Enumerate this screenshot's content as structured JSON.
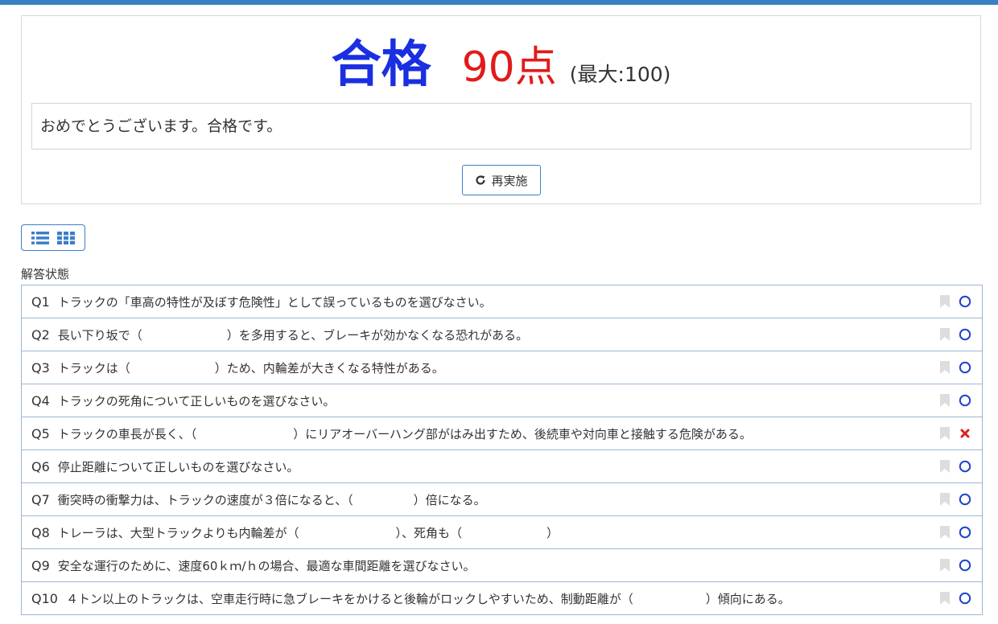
{
  "result": {
    "pass_label": "合格",
    "score": "90点",
    "max_score": "(最大:100)",
    "message": "おめでとうございます。合格です。",
    "retry_label": "再実施"
  },
  "colors": {
    "pass": "#1a2fe0",
    "score": "#e21a1a",
    "accent": "#3a7fc6",
    "correct": "#1f45c9",
    "incorrect": "#e02020",
    "bookmark": "#dddddd"
  },
  "view_toggle": {
    "icons": [
      "list-icon",
      "grid-icon"
    ]
  },
  "answer_status": {
    "label": "解答状態",
    "questions": [
      {
        "num": "Q1",
        "text": "トラックの「車高の特性が及ぼす危険性」として誤っているものを選びなさい。",
        "result": "correct"
      },
      {
        "num": "Q2",
        "text": "長い下り坂で（　　　　　　　）を多用すると、ブレーキが効かなくなる恐れがある。",
        "result": "correct"
      },
      {
        "num": "Q3",
        "text": "トラックは（　　　　　　　）ため、内輪差が大きくなる特性がある。",
        "result": "correct"
      },
      {
        "num": "Q4",
        "text": "トラックの死角について正しいものを選びなさい。",
        "result": "correct"
      },
      {
        "num": "Q5",
        "text": "トラックの車長が長く、（　　　　　　　　）にリアオーバーハング部がはみ出すため、後続車や対向車と接触する危険がある。",
        "result": "incorrect"
      },
      {
        "num": "Q6",
        "text": "停止距離について正しいものを選びなさい。",
        "result": "correct"
      },
      {
        "num": "Q7",
        "text": "衝突時の衝撃力は、トラックの速度が３倍になると、（　　　　　）倍になる。",
        "result": "correct"
      },
      {
        "num": "Q8",
        "text": "トレーラは、大型トラックよりも内輪差が（　　　　　　　　）、死角も（　　　　　　　）",
        "result": "correct"
      },
      {
        "num": "Q9",
        "text": "安全な運行のために、速度60ｋｍ/ｈの場合、最適な車間距離を選びなさい。",
        "result": "correct"
      },
      {
        "num": "Q10",
        "text": "４トン以上のトラックは、空車走行時に急ブレーキをかけると後輪がロックしやすいため、制動距離が（　　　　　　）傾向にある。",
        "result": "correct"
      }
    ]
  }
}
